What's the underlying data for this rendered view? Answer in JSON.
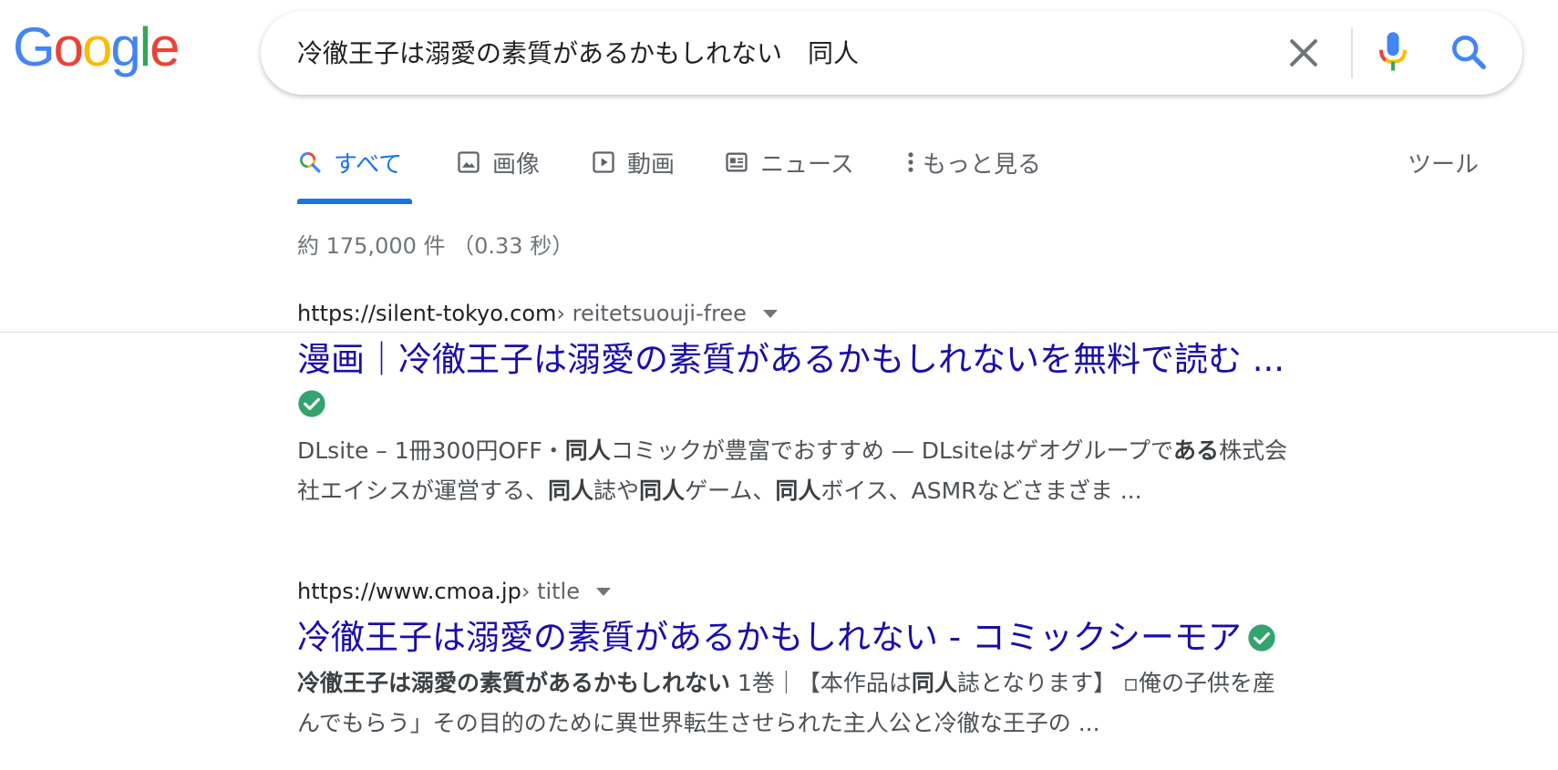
{
  "logo": {
    "letters": [
      "G",
      "o",
      "o",
      "g",
      "l",
      "e"
    ],
    "colors": [
      "#4285f4",
      "#ea4335",
      "#fbbc05",
      "#4285f4",
      "#34a853",
      "#ea4335"
    ]
  },
  "search": {
    "query": "冷徹王子は溺愛の素質があるかもしれない　同人",
    "clear_icon": "close-icon",
    "mic_icon": "microphone-icon",
    "search_icon": "search-icon"
  },
  "tabs": {
    "items": [
      {
        "label": "すべて",
        "icon": "search-icon",
        "active": true
      },
      {
        "label": "画像",
        "icon": "image-icon",
        "active": false
      },
      {
        "label": "動画",
        "icon": "video-icon",
        "active": false
      },
      {
        "label": "ニュース",
        "icon": "news-icon",
        "active": false
      },
      {
        "label": "もっと見る",
        "icon": "more-vertical-icon",
        "active": false
      }
    ],
    "tools_label": "ツール"
  },
  "result_stats": "約 175,000 件 （0.33 秒）",
  "results": [
    {
      "cite_domain": "https://silent-tokyo.com",
      "cite_path": " › reitetsuouji-free",
      "title": "漫画｜冷徹王子は溺愛の素質があるかもしれないを無料で読む ...",
      "verified": true,
      "snippet_lines": [
        [
          {
            "t": "DLsite – 1冊300円OFF・",
            "b": false
          },
          {
            "t": "同人",
            "b": true
          },
          {
            "t": "コミックが豊富でおすすめ — DLsiteはゲオグループで",
            "b": false
          },
          {
            "t": "ある",
            "b": true
          },
          {
            "t": "株式会",
            "b": false
          }
        ],
        [
          {
            "t": "社エイシスが運営する、",
            "b": false
          },
          {
            "t": "同人",
            "b": true
          },
          {
            "t": "誌や",
            "b": false
          },
          {
            "t": "同人",
            "b": true
          },
          {
            "t": "ゲーム、",
            "b": false
          },
          {
            "t": "同人",
            "b": true
          },
          {
            "t": "ボイス、ASMRなどさまざま ...",
            "b": false
          }
        ]
      ]
    },
    {
      "cite_domain": "https://www.cmoa.jp",
      "cite_path": " › title",
      "title": "冷徹王子は溺愛の素質があるかもしれない - コミックシーモア",
      "verified": true,
      "snippet_lines": [
        [
          {
            "t": "冷徹王子は溺愛の素質があるかもしれない",
            "b": true
          },
          {
            "t": " 1巻｜【本作品は",
            "b": false
          },
          {
            "t": "同人",
            "b": true
          },
          {
            "t": "誌となります】 ▫俺の子供を産",
            "b": false
          }
        ],
        [
          {
            "t": "んでもらう」その目的のために異世界転生させられた主人公と冷徹な王子の ...",
            "b": false
          }
        ]
      ]
    }
  ],
  "colors": {
    "link": "#1a0dab",
    "accent": "#1a73e8",
    "verified": "#34a36e",
    "snippet": "#4d5156"
  }
}
